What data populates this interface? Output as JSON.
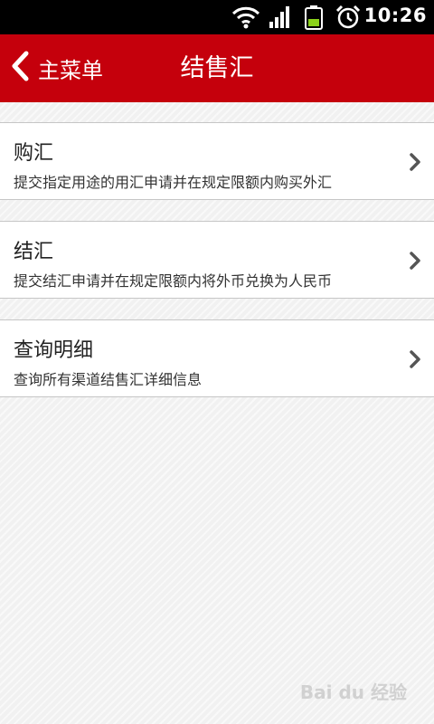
{
  "status_bar": {
    "time": "10:26",
    "icons": [
      "wifi-icon",
      "signal-icon",
      "battery-icon",
      "alarm-icon"
    ]
  },
  "header": {
    "back_label": "主菜单",
    "title": "结售汇"
  },
  "menu": {
    "items": [
      {
        "title": "购汇",
        "description": "提交指定用途的用汇申请并在规定限额内购买外汇"
      },
      {
        "title": "结汇",
        "description": "提交结汇申请并在规定限额内将外币兑换为人民币"
      },
      {
        "title": "查询明细",
        "description": "查询所有渠道结售汇详细信息"
      }
    ]
  },
  "watermark": {
    "text": "Bai du 经验"
  },
  "colors": {
    "header_bg": "#c5000c",
    "status_bar_bg": "#000000",
    "page_bg": "#f1f1f1"
  }
}
